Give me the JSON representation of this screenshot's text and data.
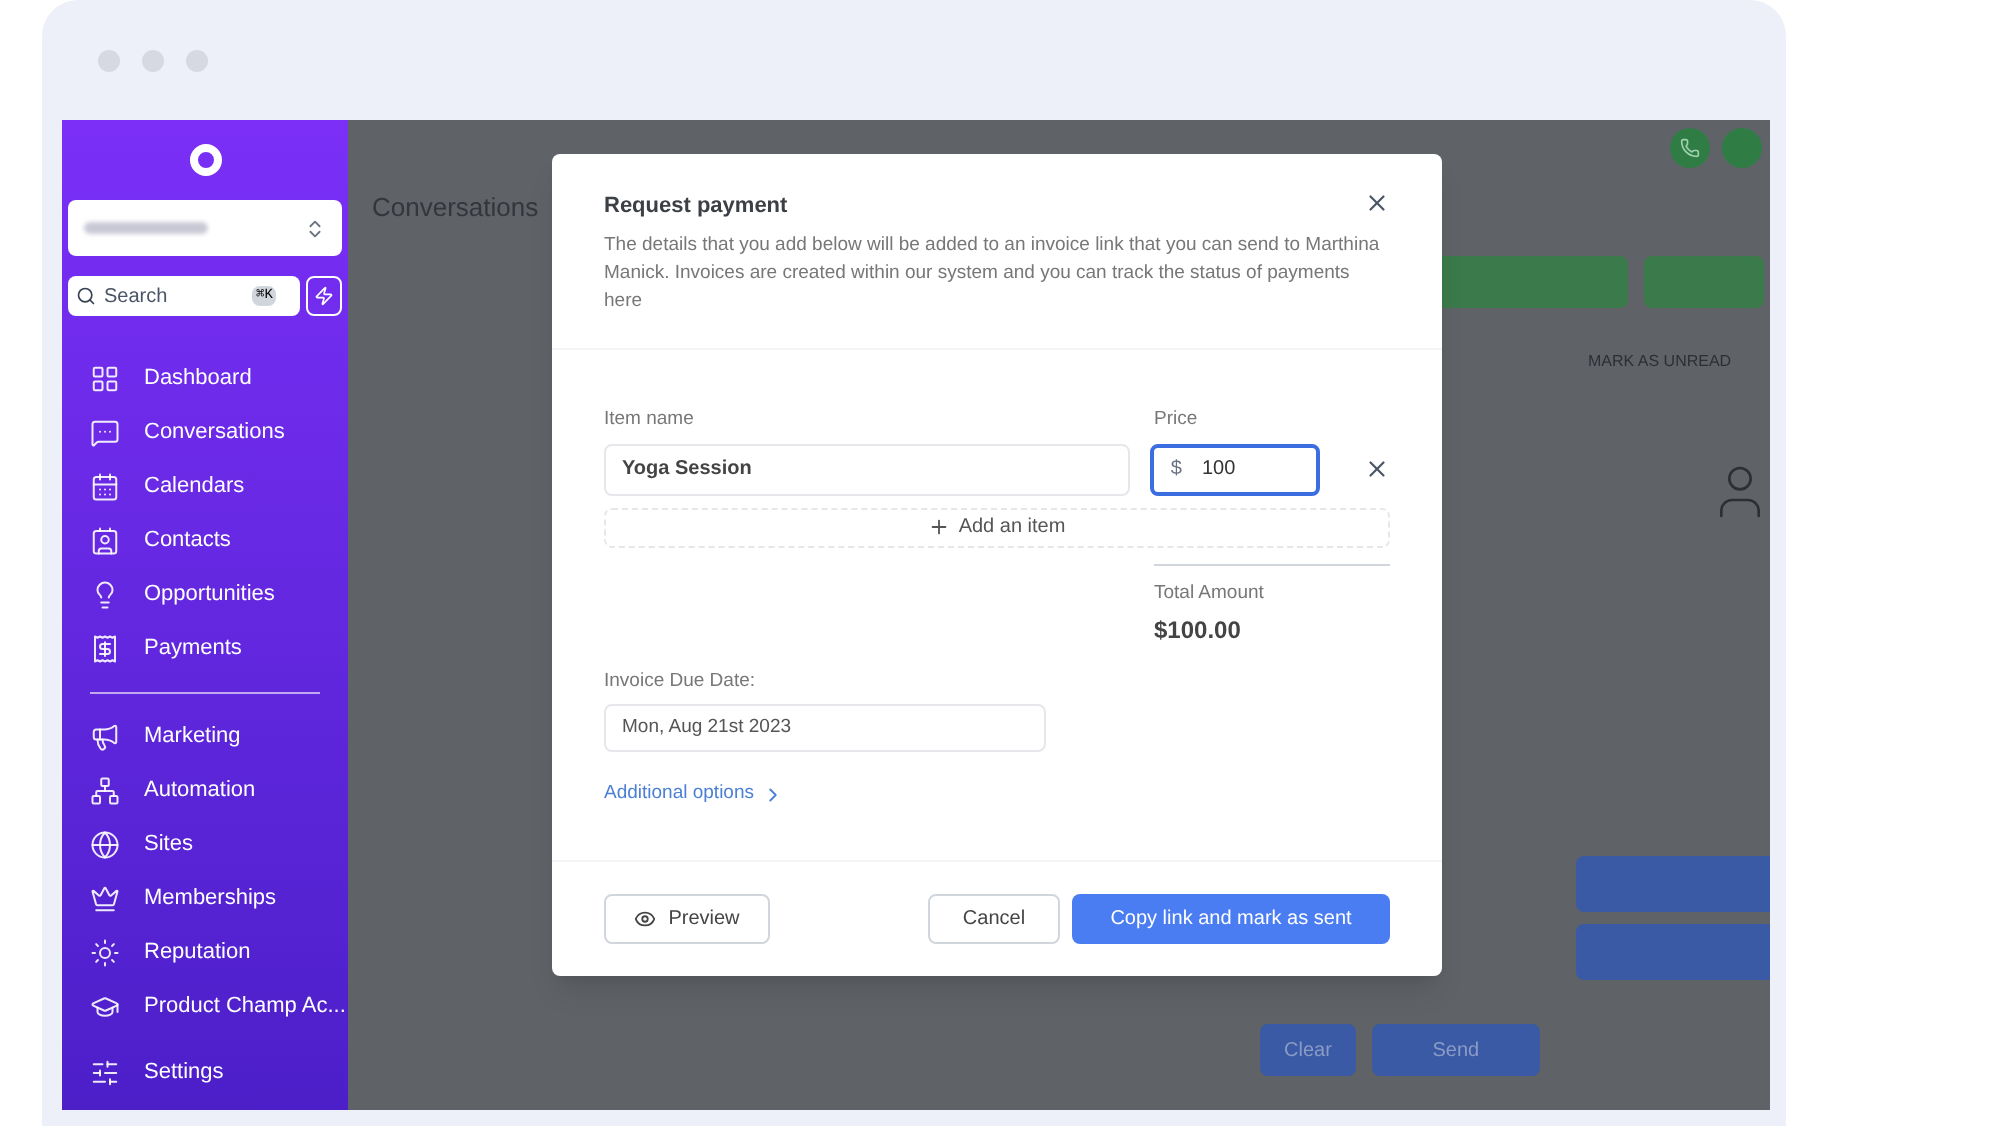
{
  "sidebar": {
    "search": {
      "placeholder": "Search",
      "shortcut": "⌘K"
    },
    "primary_items": [
      {
        "label": "Dashboard"
      },
      {
        "label": "Conversations"
      },
      {
        "label": "Calendars"
      },
      {
        "label": "Contacts"
      },
      {
        "label": "Opportunities"
      },
      {
        "label": "Payments"
      }
    ],
    "secondary_items": [
      {
        "label": "Marketing"
      },
      {
        "label": "Automation"
      },
      {
        "label": "Sites"
      },
      {
        "label": "Memberships"
      },
      {
        "label": "Reputation"
      },
      {
        "label": "Product Champ Ac..."
      }
    ],
    "settings": {
      "label": "Settings"
    }
  },
  "background": {
    "title": "Conversations",
    "mark_unread": "MARK AS UNREAD",
    "buttons": [
      "Clear",
      "Send"
    ]
  },
  "dialog": {
    "title": "Request payment",
    "description": "The details that you add below will be added to an invoice link that you can send to Marthina Manick. Invoices are created within our system and you can track the status of payments here",
    "item_name_label": "Item name",
    "price_label": "Price",
    "items": [
      {
        "name": "Yoga Session",
        "currency": "$",
        "price": "100"
      }
    ],
    "add_item": "Add an item",
    "total_label": "Total Amount",
    "total": "$100.00",
    "due_date_label": "Invoice Due Date:",
    "due_date": "Mon, Aug 21st 2023",
    "additional_options": "Additional options",
    "preview": "Preview",
    "cancel": "Cancel",
    "submit": "Copy link and mark as sent"
  }
}
